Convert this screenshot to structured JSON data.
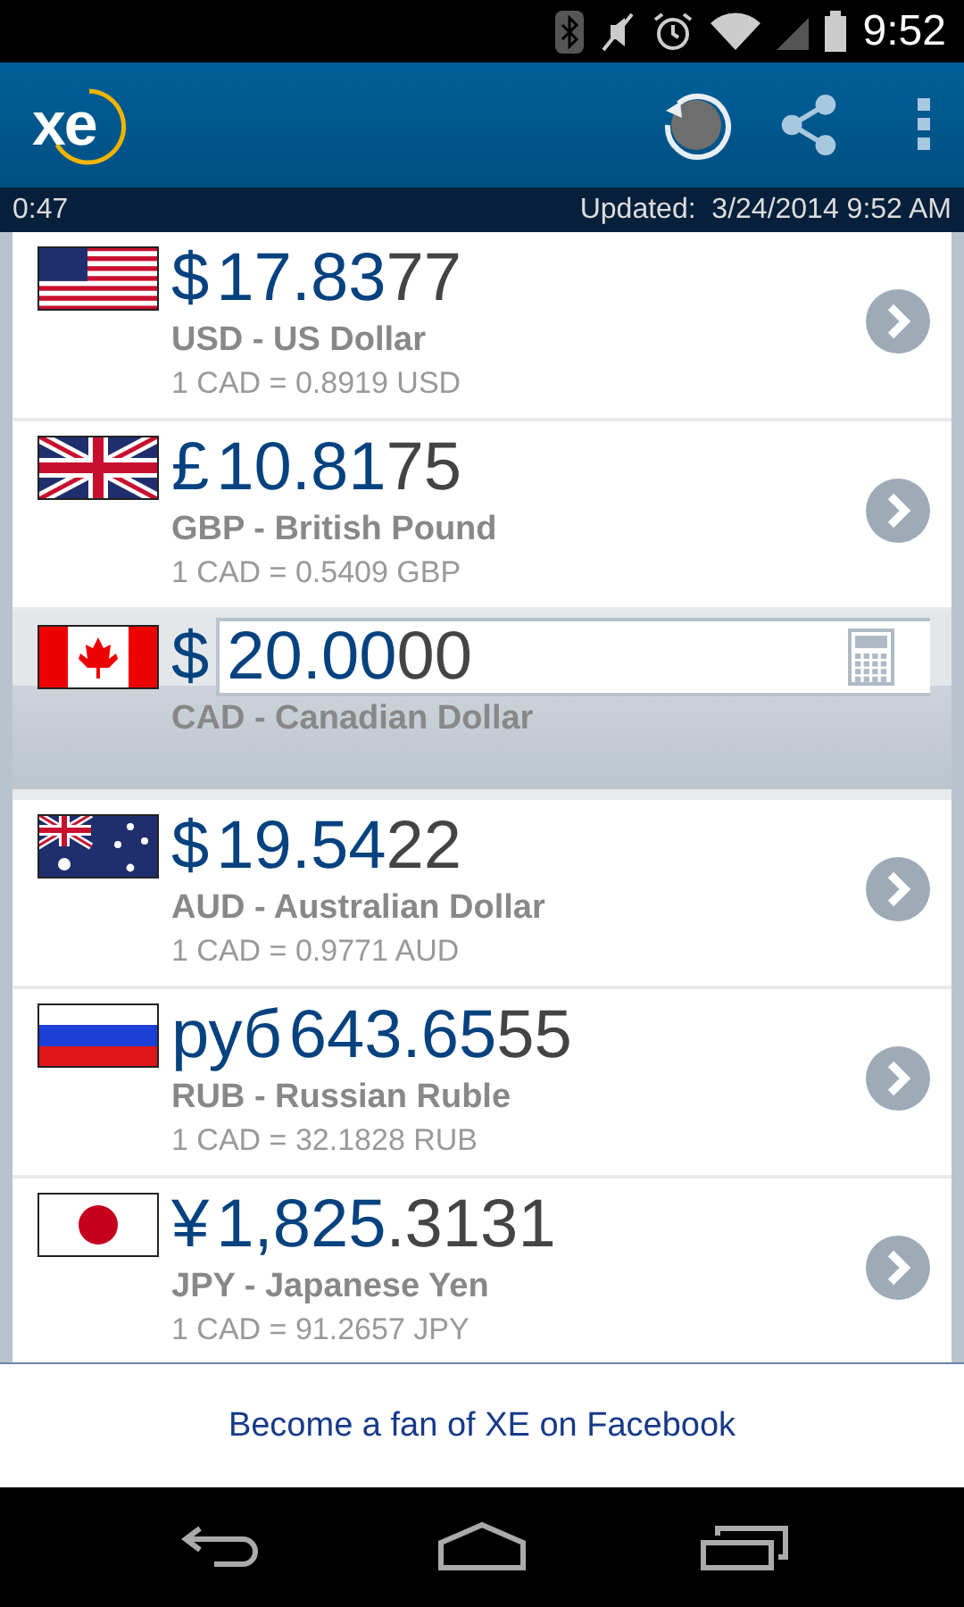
{
  "status_bar": {
    "time": "9:52"
  },
  "app_bar": {
    "logo": "xe"
  },
  "info_bar": {
    "countdown": "0:47",
    "updated": "Updated:  3/24/2014 9:52 AM"
  },
  "currencies": [
    {
      "kind": "quote",
      "symbol": "$",
      "amount_main": "17.83",
      "amount_tail": "77",
      "name": "USD - US Dollar",
      "rate": "1 CAD = 0.8919 USD"
    },
    {
      "kind": "quote",
      "symbol": "£",
      "amount_main": "10.81",
      "amount_tail": "75",
      "name": "GBP - British Pound",
      "rate": "1 CAD = 0.5409 GBP"
    },
    {
      "kind": "base",
      "symbol": "$",
      "amount_main": "20.00",
      "amount_tail": "00",
      "name": "CAD - Canadian Dollar"
    },
    {
      "kind": "quote",
      "symbol": "$",
      "amount_main": "19.54",
      "amount_tail": "22",
      "name": "AUD - Australian Dollar",
      "rate": "1 CAD = 0.9771 AUD"
    },
    {
      "kind": "quote",
      "symbol": "руб",
      "amount_main": "643.65",
      "amount_tail": "55",
      "name": "RUB - Russian Ruble",
      "rate": "1 CAD = 32.1828 RUB"
    },
    {
      "kind": "quote",
      "symbol": "¥",
      "amount_main": "1,825",
      "amount_tail": ".3131",
      "name": "JPY - Japanese Yen",
      "rate": "1 CAD = 91.2657 JPY"
    }
  ],
  "footer": {
    "link": "Become a fan of XE on Facebook"
  }
}
